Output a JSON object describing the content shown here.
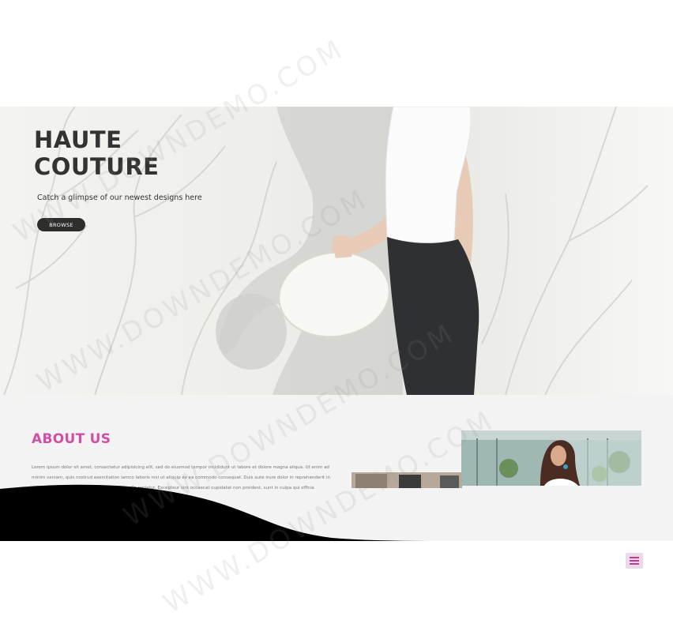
{
  "hero": {
    "title": "HAUTE COUTURE",
    "subtitle": "Catch a glimpse of our newest designs here",
    "browse_label": "BROWSE"
  },
  "about": {
    "title": "ABOUT US",
    "text": "Lorem ipsum dolor sit amet, consectetur adipisicing elit, sed do eiusmod tempor incididunt ut labore et dolore magna aliqua. Ut enim ad minim veniam, quis nostrud exercitation lamco laboris nisi ut aliquip ex ea commodo consequat. Duis aute irure dolor in reprehenderit in voluptate velit esse cillum dolore eu fugiat nulla pariatur. Excepteur sint occaecat cupidatat non proident, sunt in culpa qui officia deserunt mollit anim id"
  },
  "menu": {
    "icon": "hamburger-icon"
  },
  "watermark": {
    "text": "WWW.DOWNDEMO.COM"
  },
  "colors": {
    "accent": "#d24ea6",
    "button_dark": "#2e2e2e",
    "menu_bg": "#ead9e6",
    "section_bg": "#f3f3f3"
  }
}
